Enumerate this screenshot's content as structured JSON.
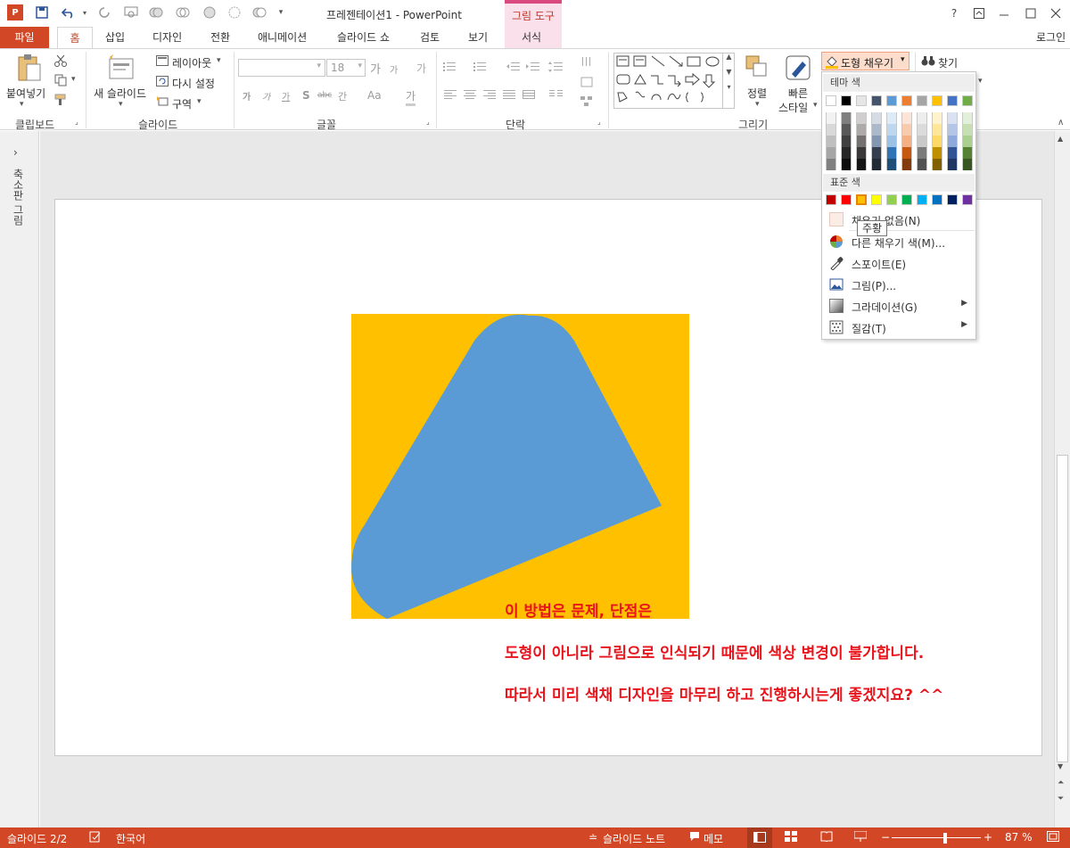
{
  "window": {
    "title": "프레젠테이션1 - PowerPoint",
    "context_tab_group": "그림 도구",
    "help": "?",
    "login": "로그인"
  },
  "tabs": [
    "파일",
    "홈",
    "삽입",
    "디자인",
    "전환",
    "애니메이션",
    "슬라이드 쇼",
    "검토",
    "보기",
    "서식"
  ],
  "ribbon": {
    "clipboard": {
      "paste": "붙여넣기",
      "group": "클립보드"
    },
    "slides": {
      "new_slide": "새 슬라이드",
      "layout": "레이아웃",
      "reset": "다시 설정",
      "section": "구역",
      "group": "슬라이드"
    },
    "font": {
      "size": "18",
      "bold": "가",
      "italic": "가",
      "underline": "가",
      "shadow": "S",
      "strike": "abc",
      "spacing": "간",
      "case": "Aa",
      "color": "가",
      "grow": "가",
      "shrink": "가",
      "clear": "가",
      "group": "글꼴"
    },
    "paragraph": {
      "group": "단락"
    },
    "drawing": {
      "arrange": "정렬",
      "quick_styles_1": "빠른",
      "quick_styles_2": "스타일",
      "fill": "도형 채우기",
      "group": "그리기"
    },
    "editing": {
      "find": "찾기"
    }
  },
  "left_pane": {
    "label": "축소판 그림",
    "toggle": "›"
  },
  "slide": {
    "shape_colors": {
      "background": "#FFC000",
      "shape": "#5B9BD5"
    },
    "text_lines": [
      "이 방법은 문제, 단점은",
      "도형이 아니라 그림으로 인식되기 때문에 색상 변경이 불가합니다.",
      "따라서 미리 색채 디자인을 마무리 하고 진행하시는게 좋겠지요? ^^"
    ],
    "text_color": "#E8141C"
  },
  "fill_dropdown": {
    "theme_colors_header": "테마 색",
    "theme_top_row": [
      "#FFFFFF",
      "#000000",
      "#E7E6E6",
      "#44546A",
      "#5B9BD5",
      "#ED7D31",
      "#A5A5A5",
      "#FFC000",
      "#4472C4",
      "#70AD47"
    ],
    "theme_shades": [
      [
        "#F2F2F2",
        "#7F7F7F",
        "#D0CECE",
        "#D6DCE4",
        "#DDEBF7",
        "#FCE4D6",
        "#EDEDED",
        "#FFF2CC",
        "#D9E1F2",
        "#E2EFDA"
      ],
      [
        "#D9D9D9",
        "#595959",
        "#AEAAAA",
        "#ACB9CA",
        "#BDD7EE",
        "#F8CBAD",
        "#DBDBDB",
        "#FFE699",
        "#B4C6E7",
        "#C6E0B4"
      ],
      [
        "#BFBFBF",
        "#404040",
        "#757171",
        "#8497B0",
        "#9BC2E6",
        "#F4B084",
        "#C9C9C9",
        "#FFD966",
        "#8EA9DB",
        "#A9D08E"
      ],
      [
        "#A6A6A6",
        "#262626",
        "#3A3838",
        "#333F4F",
        "#2F75B5",
        "#C65911",
        "#7B7B7B",
        "#BF8F00",
        "#305496",
        "#548235"
      ],
      [
        "#808080",
        "#0D0D0D",
        "#161616",
        "#222B35",
        "#1F4E78",
        "#833C0C",
        "#525252",
        "#806000",
        "#203764",
        "#375623"
      ]
    ],
    "standard_header": "표준 색",
    "standard_colors": [
      "#C00000",
      "#FF0000",
      "#FFC000",
      "#FFFF00",
      "#92D050",
      "#00B050",
      "#00B0F0",
      "#0070C0",
      "#002060",
      "#7030A0"
    ],
    "no_fill": "채우기 없음(N)",
    "more_colors": "다른 채우기 색(M)...",
    "eyedropper": "스포이트(E)",
    "picture": "그림(P)...",
    "gradient": "그라데이션(G)",
    "texture": "질감(T)",
    "tooltip": "주황"
  },
  "status": {
    "slide_info": "슬라이드 2/2",
    "language": "한국어",
    "notes": "슬라이드 노트",
    "comments": "메모",
    "zoom": "87 %",
    "zoom_level": 0.6
  }
}
